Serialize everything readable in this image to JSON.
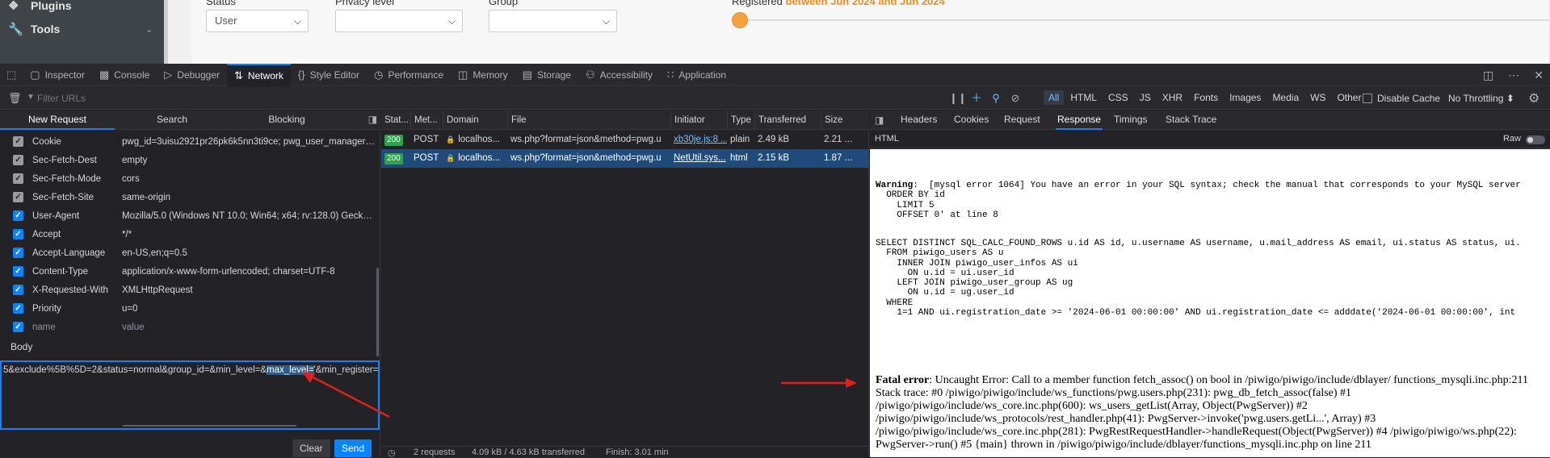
{
  "page": {
    "sidebar": [
      {
        "label": "Plugins",
        "icon": "puzzle-icon"
      },
      {
        "label": "Tools",
        "icon": "wrench-icon"
      }
    ],
    "filters": {
      "status_label": "Status",
      "status_value": "User",
      "privacy_label": "Privacy level",
      "privacy_value": "",
      "group_label": "Group",
      "group_value": "",
      "registered_label": "Registered",
      "registered_range": "between Jun 2024 and Jun 2024"
    }
  },
  "devtools": {
    "tabs": [
      {
        "label": "Inspector",
        "icon": "inspector-icon"
      },
      {
        "label": "Console",
        "icon": "console-icon"
      },
      {
        "label": "Debugger",
        "icon": "debugger-icon"
      },
      {
        "label": "Network",
        "icon": "network-icon",
        "active": true
      },
      {
        "label": "Style Editor",
        "icon": "style-editor-icon"
      },
      {
        "label": "Performance",
        "icon": "performance-icon"
      },
      {
        "label": "Memory",
        "icon": "memory-icon"
      },
      {
        "label": "Storage",
        "icon": "storage-icon"
      },
      {
        "label": "Accessibility",
        "icon": "accessibility-icon"
      },
      {
        "label": "Application",
        "icon": "application-icon"
      }
    ],
    "filter_placeholder": "Filter URLs",
    "type_filters": [
      "All",
      "HTML",
      "CSS",
      "JS",
      "XHR",
      "Fonts",
      "Images",
      "Media",
      "WS",
      "Other"
    ],
    "disable_cache": "Disable Cache",
    "throttling": "No Throttling ⬍"
  },
  "new_request": {
    "tabs": [
      "New Request",
      "Search",
      "Blocking"
    ],
    "headers": [
      {
        "name": "Cookie",
        "value": "pwg_id=3uisu2921pr26pk6k5nn3ti9ce; pwg_user_manager_...",
        "checked": true,
        "style": "grey"
      },
      {
        "name": "Sec-Fetch-Dest",
        "value": "empty",
        "checked": true,
        "style": "grey"
      },
      {
        "name": "Sec-Fetch-Mode",
        "value": "cors",
        "checked": true,
        "style": "grey"
      },
      {
        "name": "Sec-Fetch-Site",
        "value": "same-origin",
        "checked": true,
        "style": "grey"
      },
      {
        "name": "User-Agent",
        "value": "Mozilla/5.0 (Windows NT 10.0; Win64; x64; rv:128.0) Gecko/2...",
        "checked": true,
        "style": "blue"
      },
      {
        "name": "Accept",
        "value": "*/*",
        "checked": true,
        "style": "blue"
      },
      {
        "name": "Accept-Language",
        "value": "en-US,en;q=0.5",
        "checked": true,
        "style": "blue"
      },
      {
        "name": "Content-Type",
        "value": "application/x-www-form-urlencoded; charset=UTF-8",
        "checked": true,
        "style": "blue"
      },
      {
        "name": "X-Requested-With",
        "value": "XMLHttpRequest",
        "checked": true,
        "style": "blue"
      },
      {
        "name": "Priority",
        "value": "u=0",
        "checked": true,
        "style": "blue"
      },
      {
        "name": "name",
        "value": "value",
        "checked": true,
        "style": "blue",
        "placeholder": true
      }
    ],
    "body_label": "Body",
    "body_pre": "5&exclude%5B%5D=2&status=normal&group_id=&min_level=&",
    "body_highlight": "max_level=",
    "body_post": "'&min_register=",
    "clear": "Clear",
    "send": "Send"
  },
  "request_list": {
    "columns": [
      "Stat...",
      "Met...",
      "Domain",
      "File",
      "Initiator",
      "Type",
      "Transferred",
      "Size"
    ],
    "rows": [
      {
        "status": "200",
        "method": "POST",
        "domain": "localhos...",
        "file": "ws.php?format=json&method=pwg.u",
        "initiator": "xb30je.js:8 ...",
        "type": "plain",
        "transferred": "2.49 kB",
        "size": "2.21 ..."
      },
      {
        "status": "200",
        "method": "POST",
        "domain": "localhos...",
        "file": "ws.php?format=json&method=pwg.u",
        "initiator": "NetUtil.sys...",
        "type": "html",
        "transferred": "2.15 kB",
        "size": "1.87 ..."
      }
    ],
    "footer": {
      "requests": "2 requests",
      "transferred": "4.09 kB / 4.63 kB transferred",
      "finish": "Finish: 3.01 min"
    }
  },
  "details": {
    "tabs": [
      "Headers",
      "Cookies",
      "Request",
      "Response",
      "Timings",
      "Stack Trace"
    ],
    "active_tab": "Response",
    "format_label": "HTML",
    "raw_label": "Raw",
    "warning_label": "Warning",
    "warning_text": ":  [mysql error 1064] You have an error in your SQL syntax; check the manual that corresponds to your MySQL server",
    "warning_lines": "  ORDER BY id\n    LIMIT 5\n    OFFSET 0' at line 8",
    "sql": "SELECT DISTINCT SQL_CALC_FOUND_ROWS u.id AS id, u.username AS username, u.mail_address AS email, ui.status AS status, ui.\n  FROM piwigo_users AS u\n    INNER JOIN piwigo_user_infos AS ui\n      ON u.id = ui.user_id\n    LEFT JOIN piwigo_user_group AS ug\n      ON u.id = ug.user_id\n  WHERE\n    1=1 AND ui.registration_date >= '2024-06-01 00:00:00' AND ui.registration_date <= adddate('2024-06-01 00:00:00', int",
    "fatal_label": "Fatal error",
    "fatal_text": ": Uncaught Error: Call to a member function fetch_assoc() on bool in /piwigo/piwigo/include/dblayer/ functions_mysqli.inc.php:211 Stack trace: #0 /piwigo/piwigo/include/ws_functions/pwg.users.php(231): pwg_db_fetch_assoc(false) #1 /piwigo/piwigo/include/ws_core.inc.php(600): ws_users_getList(Array, Object(PwgServer)) #2 /piwigo/piwigo/include/ws_protocols/rest_handler.php(41): PwgServer->invoke('pwg.users.getLi...', Array) #3 /piwigo/piwigo/include/ws_core.inc.php(281): PwgRestRequestHandler->handleRequest(Object(PwgServer)) #4 /piwigo/piwigo/ws.php(22): PwgServer->run() #5 {main} thrown in /piwigo/piwigo/include/dblayer/functions_mysqli.inc.php on line 211"
  },
  "colors": {
    "accent": "#0a84ff",
    "status_ok": "#30a14e",
    "annotation": "#e02020",
    "registered_range": "#f28c1d"
  }
}
